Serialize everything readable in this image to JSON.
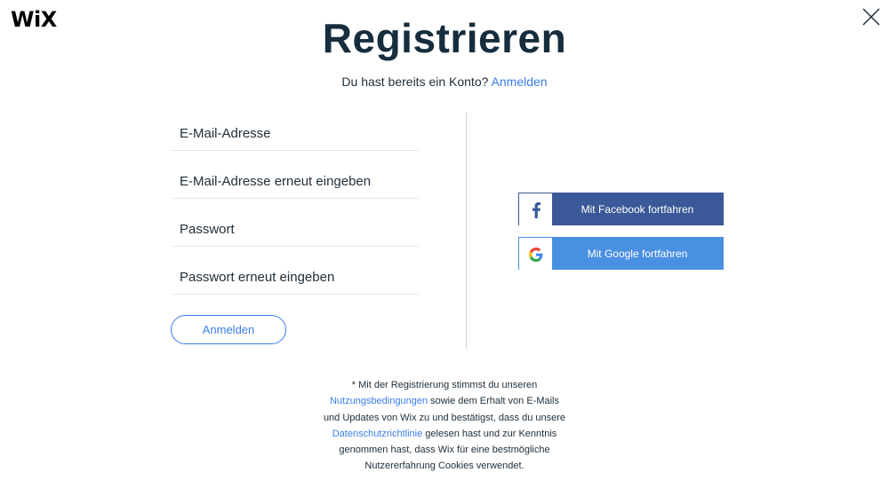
{
  "brand": {
    "logo": "WiX"
  },
  "header": {
    "title": "Registrieren",
    "subtitle": "Du hast bereits ein Konto?",
    "subtitle_link": "Anmelden"
  },
  "form": {
    "email_placeholder": "E-Mail-Adresse",
    "email_confirm_placeholder": "E-Mail-Adresse erneut eingeben",
    "password_placeholder": "Passwort",
    "password_confirm_placeholder": "Passwort erneut eingeben",
    "submit_label": "Anmelden"
  },
  "social": {
    "facebook_label": "Mit Facebook fortfahren",
    "google_label": "Mit Google fortfahren"
  },
  "terms": {
    "line1": "* Mit der Registrierung stimmst du unseren",
    "link1": "Nutzungsbedingungen",
    "line2": " sowie dem Erhalt von E-Mails",
    "line3": "und Updates von Wix zu und bestätigst, dass du unsere",
    "link2": "Datenschutzrichtlinie",
    "line4": " gelesen hast und zur Kenntnis",
    "line5": "genommen hast, dass Wix für eine bestmögliche",
    "line6": "Nutzererfahrung Cookies verwendet."
  },
  "colors": {
    "accent": "#3b7de8",
    "facebook": "#3b5998",
    "google": "#4a90e2",
    "title": "#162d3d"
  }
}
